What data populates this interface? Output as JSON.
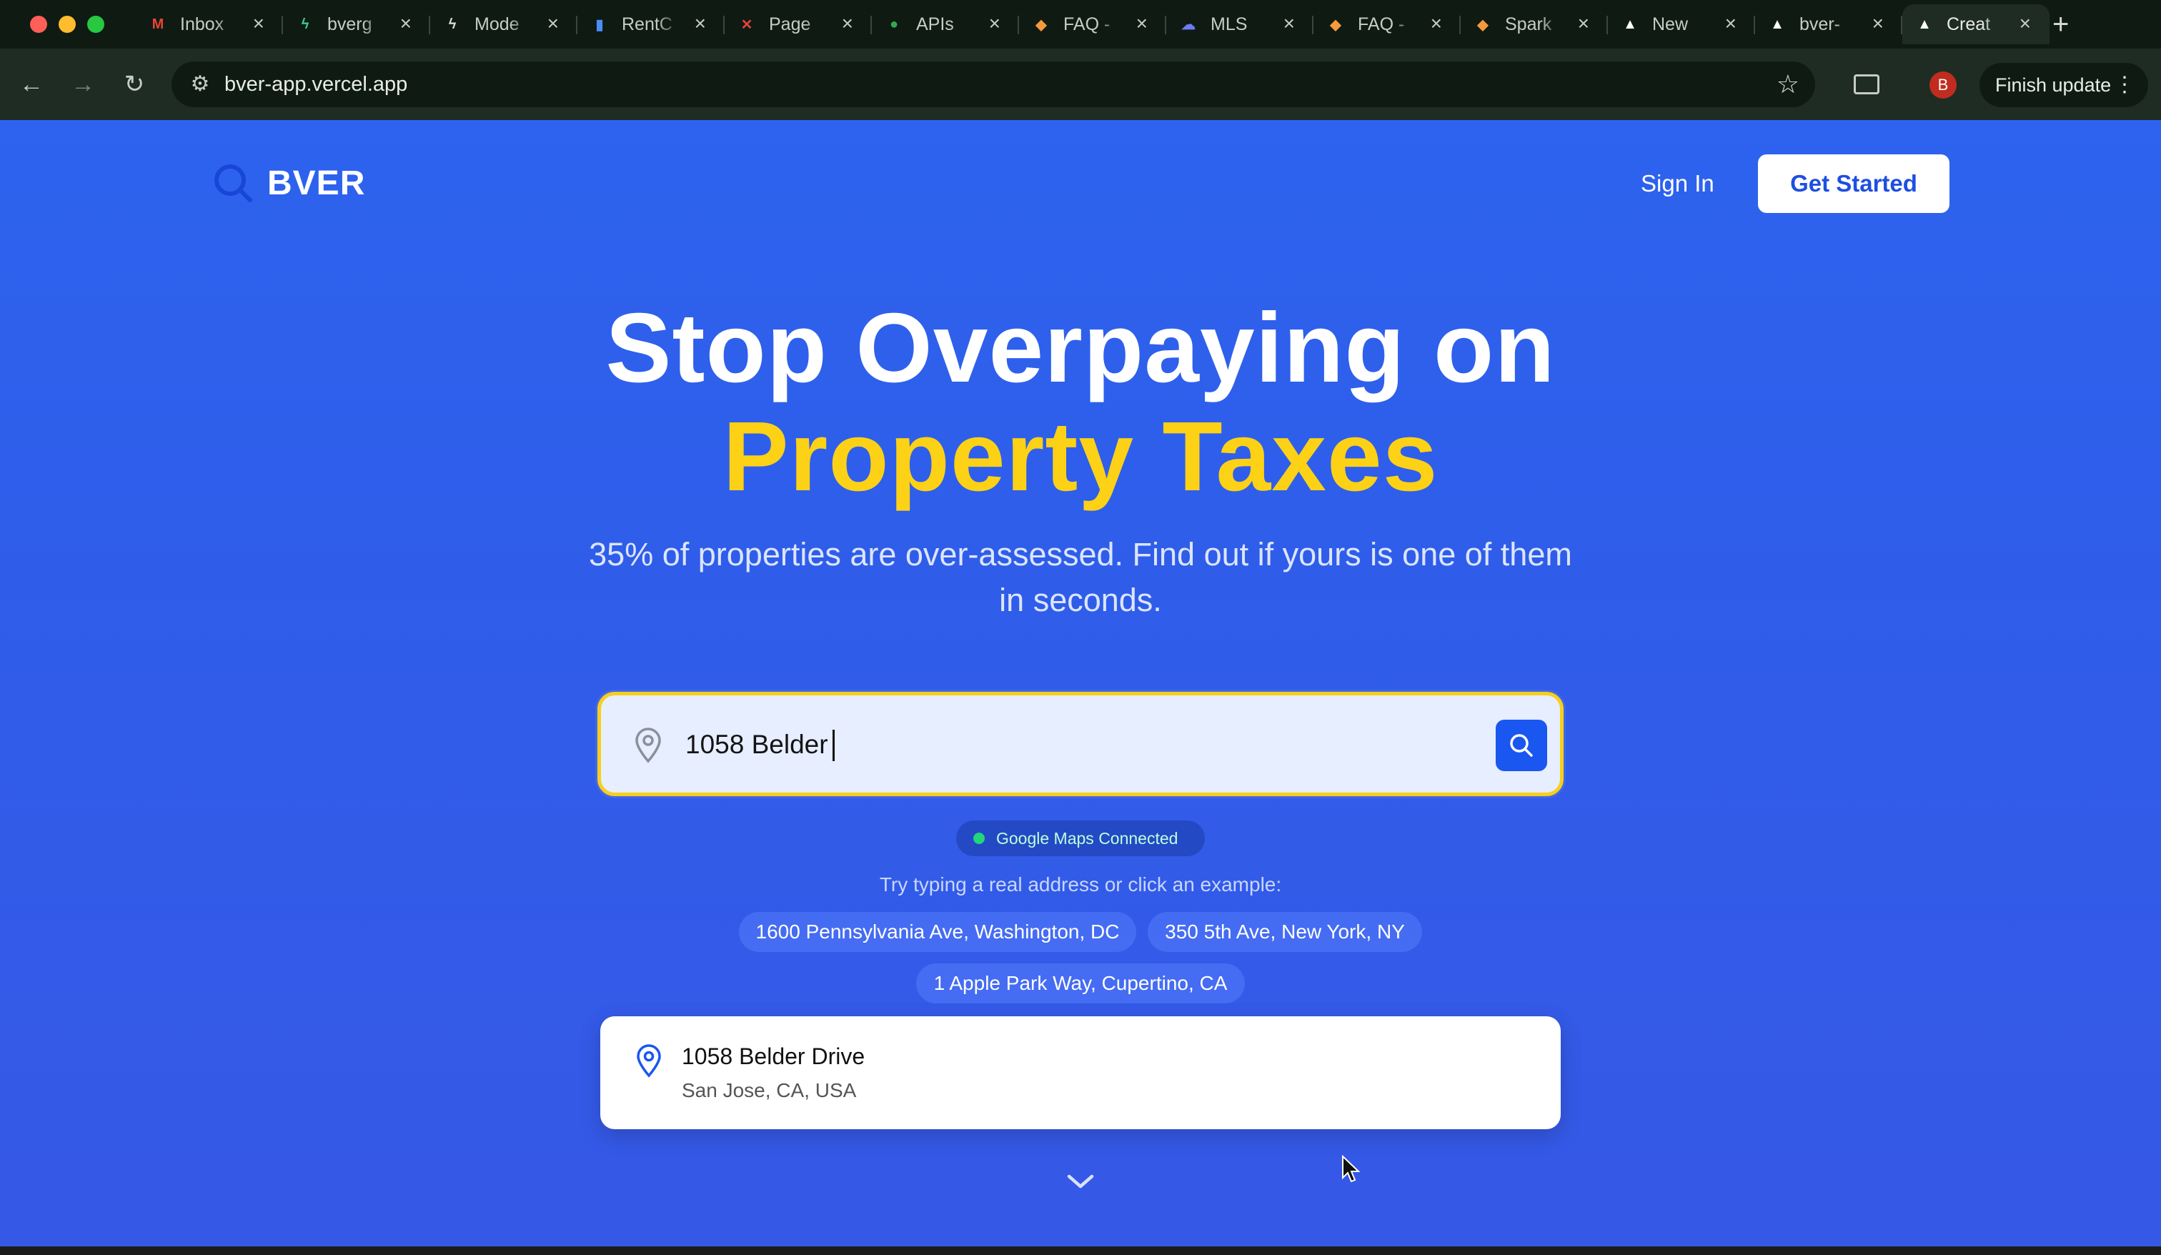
{
  "browser": {
    "tabs": [
      {
        "title": "Inbox",
        "icon": "gmail-icon",
        "color": "#ea4335",
        "glyph": "M"
      },
      {
        "title": "bverg",
        "icon": "bolt-icon",
        "color": "#3ecf8e",
        "glyph": "ϟ"
      },
      {
        "title": "Mode",
        "icon": "bolt-icon",
        "color": "#dddddd",
        "glyph": "ϟ"
      },
      {
        "title": "RentC",
        "icon": "bar-chart-icon",
        "color": "#4b8cf5",
        "glyph": "▮"
      },
      {
        "title": "Page",
        "icon": "page-icon",
        "color": "#e0443a",
        "glyph": "✕"
      },
      {
        "title": "APIs",
        "icon": "maps-pin-icon",
        "color": "#34a853",
        "glyph": "●"
      },
      {
        "title": "FAQ -",
        "icon": "spark-icon",
        "color": "#f59a3c",
        "glyph": "◆"
      },
      {
        "title": "MLS",
        "icon": "cloud-icon",
        "color": "#6d7cf0",
        "glyph": "☁"
      },
      {
        "title": "FAQ -",
        "icon": "spark-icon",
        "color": "#f59a3c",
        "glyph": "◆"
      },
      {
        "title": "Spark",
        "icon": "spark-icon",
        "color": "#f59a3c",
        "glyph": "◆"
      },
      {
        "title": "New",
        "icon": "vercel-icon",
        "color": "#ffffff",
        "glyph": "▲"
      },
      {
        "title": "bver-",
        "icon": "vercel-icon",
        "color": "#ffffff",
        "glyph": "▲"
      },
      {
        "title": "Creat",
        "icon": "vercel-icon",
        "color": "#ffffff",
        "glyph": "▲",
        "active": true
      }
    ],
    "new_tab": "+",
    "url": "bver-app.vercel.app",
    "profile_initial": "B",
    "update_label": "Finish update",
    "accent": "#1f2c23"
  },
  "site": {
    "logo_text": "BVER",
    "nav": {
      "sign_in": "Sign In",
      "get_started": "Get Started"
    },
    "hero": {
      "line1": "Stop Overpaying on",
      "line2": "Property Taxes",
      "subtitle": "35% of properties are over-assessed. Find out if yours is one of them in seconds."
    },
    "search": {
      "value": "1058 Belder",
      "placeholder": ""
    },
    "maps_status": "Google Maps Connected",
    "examples_prompt": "Try typing a real address or click an example:",
    "examples": [
      "1600 Pennsylvania Ave, Washington, DC",
      "350 5th Ave, New York, NY",
      "1 Apple Park Way, Cupertino, CA"
    ],
    "suggestion": {
      "main": "1058 Belder Drive",
      "secondary": "San Jose, CA, USA"
    },
    "colors": {
      "background": "#2d63ee",
      "highlight": "#fcd116",
      "button": "#1a56f0",
      "search_border": "#f7cf1a"
    }
  }
}
